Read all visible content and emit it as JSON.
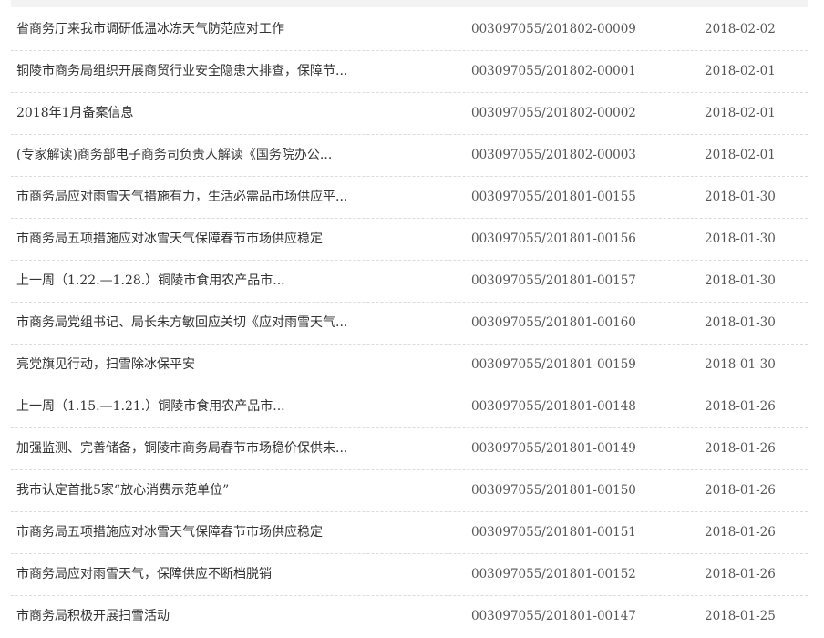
{
  "rows": [
    {
      "title": "省商务厅来我市调研低温冰冻天气防范应对工作",
      "code": "003097055/201802-00009",
      "date": "2018-02-02"
    },
    {
      "title": "铜陵市商务局组织开展商贸行业安全隐患大排查，保障节...",
      "code": "003097055/201802-00001",
      "date": "2018-02-01"
    },
    {
      "title": "2018年1月备案信息",
      "code": "003097055/201802-00002",
      "date": "2018-02-01"
    },
    {
      "title": "(专家解读)商务部电子商务司负责人解读《国务院办公...",
      "code": "003097055/201802-00003",
      "date": "2018-02-01"
    },
    {
      "title": "市商务局应对雨雪天气措施有力，生活必需品市场供应平...",
      "code": "003097055/201801-00155",
      "date": "2018-01-30"
    },
    {
      "title": "市商务局五项措施应对冰雪天气保障春节市场供应稳定",
      "code": "003097055/201801-00156",
      "date": "2018-01-30"
    },
    {
      "title": "上一周（1.22.—1.28.）铜陵市食用农产品市...",
      "code": "003097055/201801-00157",
      "date": "2018-01-30"
    },
    {
      "title": "市商务局党组书记、局长朱方敏回应关切《应对雨雪天气...",
      "code": "003097055/201801-00160",
      "date": "2018-01-30"
    },
    {
      "title": "亮党旗见行动，扫雪除冰保平安",
      "code": "003097055/201801-00159",
      "date": "2018-01-30"
    },
    {
      "title": "上一周（1.15.—1.21.）铜陵市食用农产品市...",
      "code": "003097055/201801-00148",
      "date": "2018-01-26"
    },
    {
      "title": "加强监测、完善储备，铜陵市商务局春节市场稳价保供未...",
      "code": "003097055/201801-00149",
      "date": "2018-01-26"
    },
    {
      "title": "我市认定首批5家“放心消费示范单位”",
      "code": "003097055/201801-00150",
      "date": "2018-01-26"
    },
    {
      "title": "市商务局五项措施应对冰雪天气保障春节市场供应稳定",
      "code": "003097055/201801-00151",
      "date": "2018-01-26"
    },
    {
      "title": "市商务局应对雨雪天气，保障供应不断档脱销",
      "code": "003097055/201801-00152",
      "date": "2018-01-26"
    },
    {
      "title": "市商务局积极开展扫雪活动",
      "code": "003097055/201801-00147",
      "date": "2018-01-25"
    }
  ]
}
